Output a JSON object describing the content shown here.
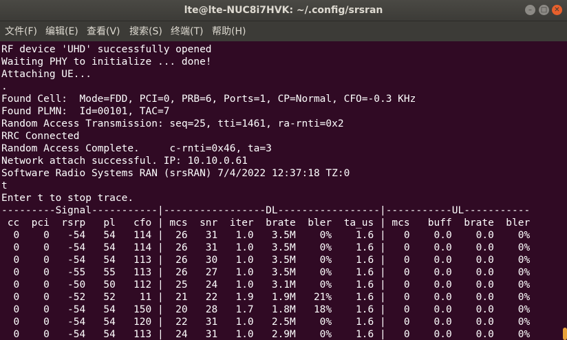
{
  "window": {
    "title": "lte@lte-NUC8i7HVK: ~/.config/srsran",
    "controls": [
      "minimize-icon",
      "maximize-icon",
      "close-icon"
    ]
  },
  "menu": {
    "file": "文件(F)",
    "edit": "编辑(E)",
    "view": "查看(V)",
    "search": "搜索(S)",
    "terminal": "终端(T)",
    "help": "帮助(H)"
  },
  "terminal": {
    "lines": [
      "RF device 'UHD' successfully opened",
      "Waiting PHY to initialize ... done!",
      "Attaching UE...",
      ".",
      "Found Cell:  Mode=FDD, PCI=0, PRB=6, Ports=1, CP=Normal, CFO=-0.3 KHz",
      "Found PLMN:  Id=00101, TAC=7",
      "Random Access Transmission: seq=25, tti=1461, ra-rnti=0x2",
      "RRC Connected",
      "Random Access Complete.     c-rnti=0x46, ta=3",
      "Network attach successful. IP: 10.10.0.61",
      "Software Radio Systems RAN (srsRAN) 7/4/2022 12:37:18 TZ:0",
      "t",
      "Enter t to stop trace.",
      "---------Signal-----------|-----------------DL-----------------|-----------UL-----------",
      " cc  pci  rsrp   pl   cfo | mcs  snr  iter  brate  bler  ta_us | mcs   buff  brate  bler",
      "  0    0   -54   54   114 |  26   31   1.0   3.5M    0%    1.6 |   0    0.0    0.0    0%",
      "  0    0   -54   54   114 |  26   31   1.0   3.5M    0%    1.6 |   0    0.0    0.0    0%",
      "  0    0   -54   54   113 |  26   30   1.0   3.5M    0%    1.6 |   0    0.0    0.0    0%",
      "  0    0   -55   55   113 |  26   27   1.0   3.5M    0%    1.6 |   0    0.0    0.0    0%",
      "  0    0   -50   50   112 |  25   24   1.0   3.1M    0%    1.6 |   0    0.0    0.0    0%",
      "  0    0   -52   52    11 |  21   22   1.9   1.9M   21%    1.6 |   0    0.0    0.0    0%",
      "  0    0   -54   54   150 |  20   28   1.7   1.8M   18%    1.6 |   0    0.0    0.0    0%",
      "  0    0   -54   54   120 |  22   31   1.0   2.5M    0%    1.6 |   0    0.0    0.0    0%",
      "  0    0   -54   54   113 |  24   31   1.0   2.9M    0%    1.6 |   0    0.0    0.0    0%"
    ]
  },
  "colors": {
    "terminal_bg": "#300a24",
    "terminal_fg": "#ffffff",
    "titlebar_bg": "#3c3b37",
    "close_button": "#e8602c",
    "scrollbar_thumb": "#e8a23a"
  }
}
